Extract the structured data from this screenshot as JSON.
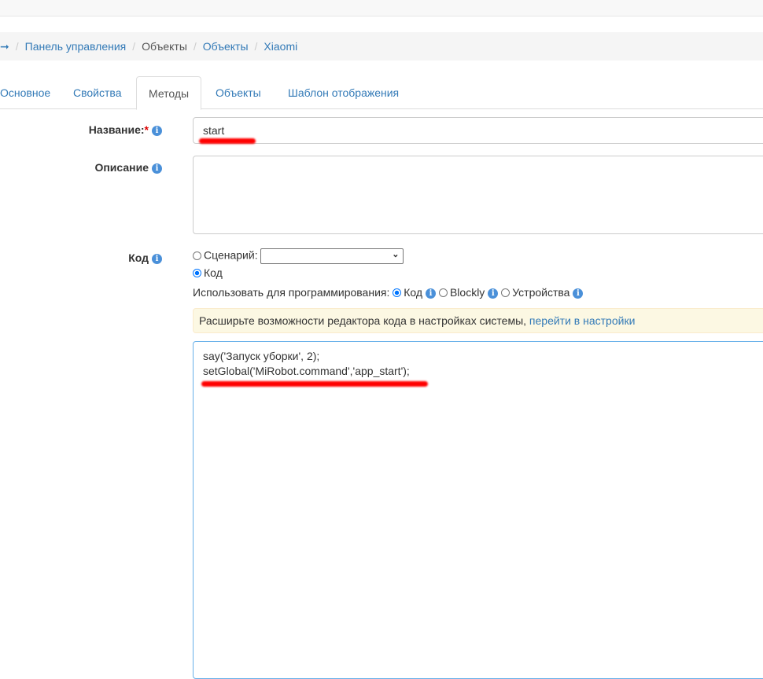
{
  "breadcrumb": {
    "home_icon": "arrow-right-icon",
    "items": [
      "Панель управления",
      "Объекты",
      "Объекты",
      "Xiaomi"
    ]
  },
  "tabs": [
    "Основное",
    "Свойства",
    "Методы",
    "Объекты",
    "Шаблон отображения"
  ],
  "active_tab": "Методы",
  "form": {
    "name_label": "Название:",
    "required_mark": "*",
    "name_value": "start",
    "description_label": "Описание",
    "description_value": "",
    "code_label": "Код",
    "scenario_option": "Сценарий:",
    "scenario_selected": "",
    "code_option": "Код",
    "programming_label": "Использовать для программирования:",
    "programming_options": [
      "Код",
      "Blockly",
      "Устройства"
    ],
    "programming_selected": "Код",
    "alert_text": "Расширьте возможности редактора кода в настройках системы, ",
    "alert_link": "перейти в настройки",
    "code_lines": [
      "say('Запуск уборки', 2);",
      "setGlobal('MiRobot.command','app_start');"
    ]
  },
  "colors": {
    "link": "#337ab7",
    "info": "#4a90d9",
    "alert_bg": "#fcf8e3",
    "marker": "#ff0000"
  }
}
